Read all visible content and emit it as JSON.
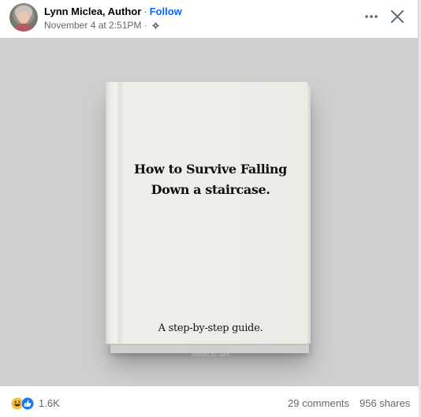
{
  "post": {
    "author_name": "Lynn Miclea, Author",
    "separator": "·",
    "follow_label": "Follow",
    "timestamp": "November 4 at 2:51PM",
    "meta_separator": "·",
    "audience_icon": "gear-icon",
    "more_icon": "more-options-icon",
    "close_icon": "close-icon"
  },
  "image": {
    "background_color": "#cfcfcf",
    "book_title_line1": "How to Survive Falling",
    "book_title_line2": "Down a staircase.",
    "book_subtitle": "A step-by-step guide.",
    "book_credit": "Memes by Sam"
  },
  "footer": {
    "reaction_icons": [
      "laughing-face-icon",
      "like-icon"
    ],
    "reaction_count": "1.6K",
    "comments": "29 comments",
    "shares": "956 shares"
  },
  "colors": {
    "accent": "#0866ff",
    "secondary_text": "#65676b",
    "like_blue": "#1877f2",
    "haha_yellow": "#f7c534"
  }
}
